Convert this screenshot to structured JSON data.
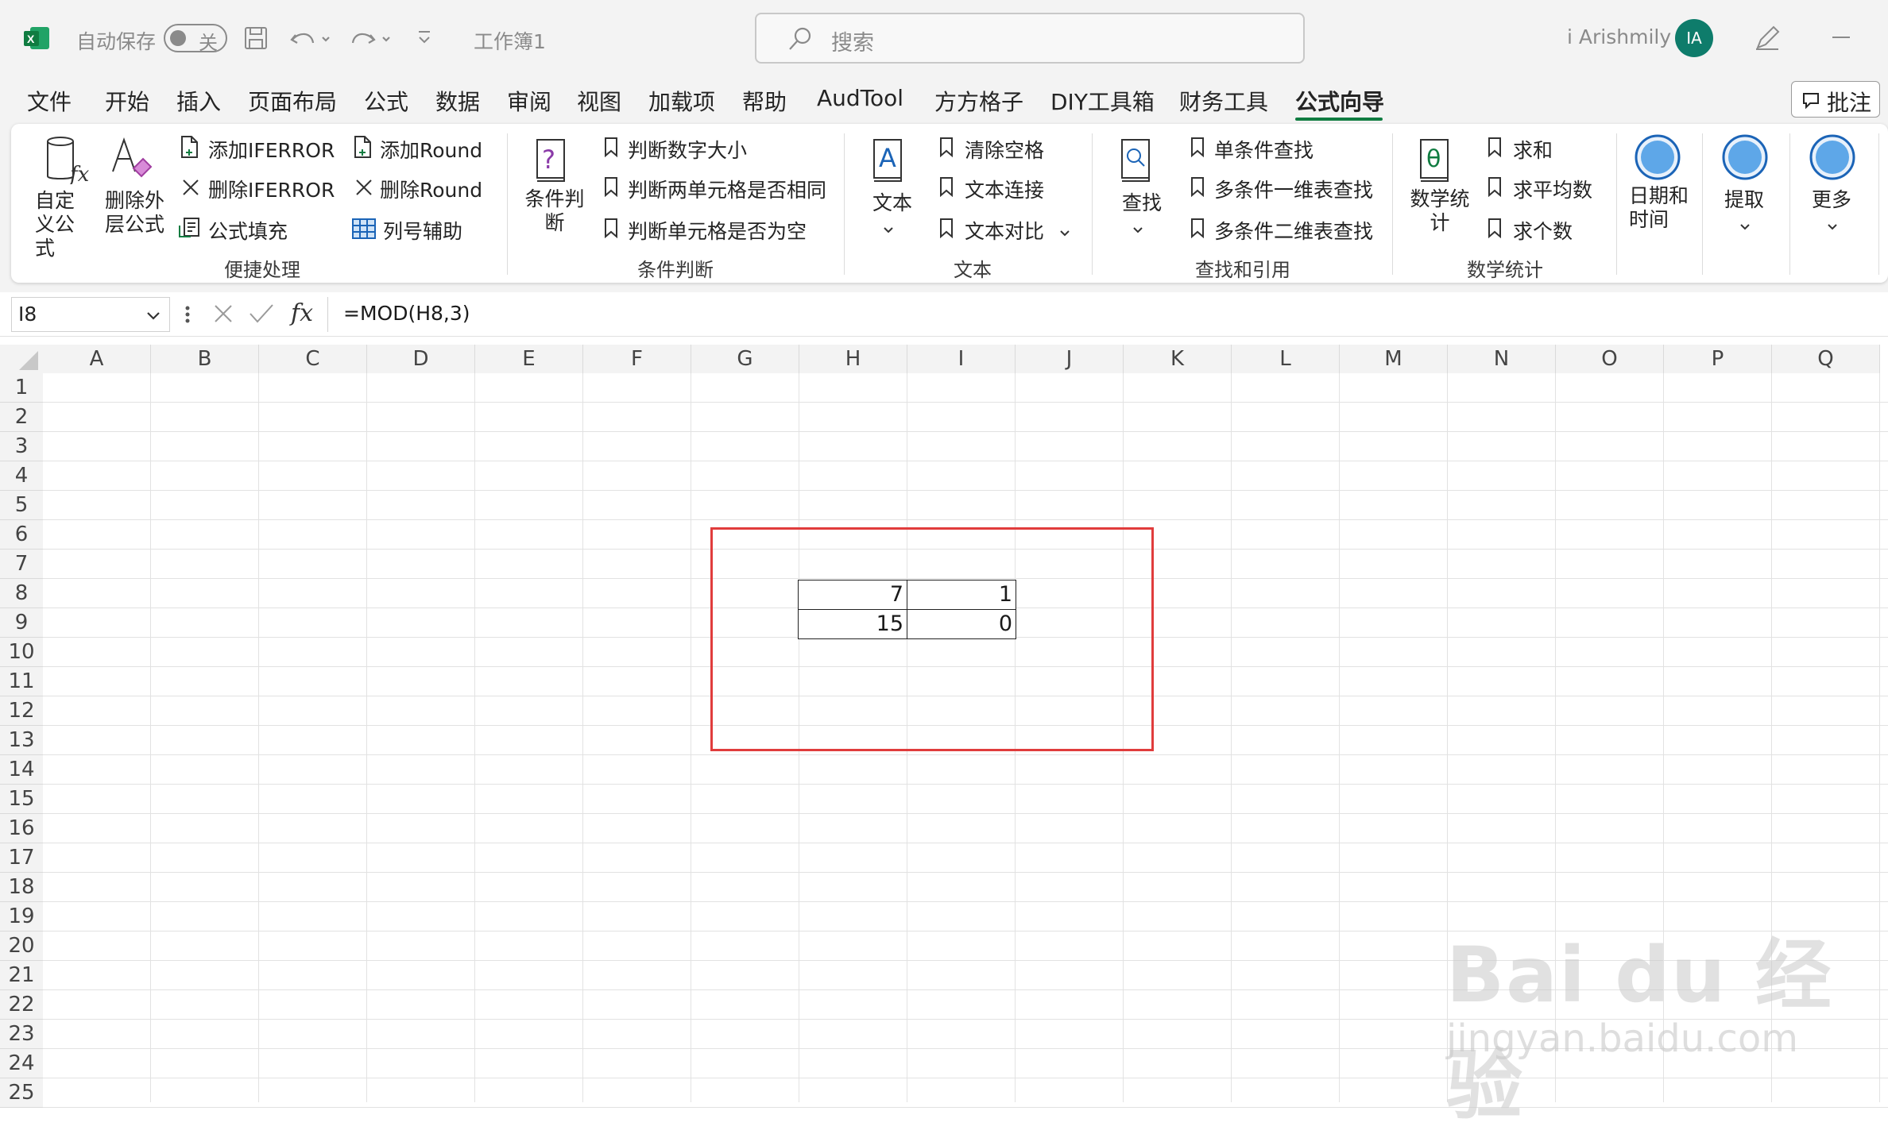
{
  "titlebar": {
    "autosave_label": "自动保存",
    "toggle_label": "关",
    "workbook_name": "工作簿1",
    "search_placeholder": "搜索",
    "user_name": "i Arishmily",
    "avatar_initials": "IA"
  },
  "menu": {
    "tabs": [
      "文件",
      "开始",
      "插入",
      "页面布局",
      "公式",
      "数据",
      "审阅",
      "视图",
      "加载项",
      "帮助",
      "AudTool",
      "方方格子",
      "DIY工具箱",
      "财务工具",
      "公式向导"
    ],
    "active": "公式向导",
    "comment_button": "批注"
  },
  "ribbon": {
    "convenience": {
      "custom_formula": "自定义公式",
      "delete_outer": "删除外层公式",
      "add_iferror": "添加IFERROR",
      "del_iferror": "删除IFERROR",
      "formula_fill": "公式填充",
      "add_round": "添加Round",
      "del_round": "删除Round",
      "col_assist": "列号辅助",
      "group": "便捷处理"
    },
    "condition": {
      "big": "条件判断",
      "item1": "判断数字大小",
      "item2": "判断两单元格是否相同",
      "item3": "判断单元格是否为空",
      "group": "条件判断"
    },
    "text": {
      "big": "文本",
      "item1": "清除空格",
      "item2": "文本连接",
      "item3": "文本对比",
      "group": "文本"
    },
    "lookup": {
      "big": "查找",
      "item1": "单条件查找",
      "item2": "多条件一维表查找",
      "item3": "多条件二维表查找",
      "group": "查找和引用"
    },
    "math": {
      "big": "数学统计",
      "item1": "求和",
      "item2": "求平均数",
      "item3": "求个数",
      "group": "数学统计"
    },
    "datetime": {
      "label": "日期和时间"
    },
    "extract": {
      "label": "提取"
    },
    "more": {
      "label": "更多"
    }
  },
  "formula_bar": {
    "name_box": "I8",
    "formula": "=MOD(H8,3)"
  },
  "sheet": {
    "columns": [
      "A",
      "B",
      "C",
      "D",
      "E",
      "F",
      "G",
      "H",
      "I",
      "J",
      "K",
      "L",
      "M",
      "N",
      "O",
      "P",
      "Q"
    ],
    "rows": [
      "1",
      "2",
      "3",
      "4",
      "5",
      "6",
      "7",
      "8",
      "9",
      "10",
      "11",
      "12",
      "13",
      "14",
      "15",
      "16",
      "17",
      "18",
      "19",
      "20",
      "21",
      "22",
      "23",
      "24",
      "25"
    ],
    "cells": {
      "H8": "7",
      "I8": "1",
      "H9": "15",
      "I9": "0"
    }
  },
  "watermark": {
    "line1": "Bai du 经验",
    "line2": "jingyan.baidu.com"
  },
  "colors": {
    "excel_green": "#107c41",
    "highlight_red": "#e03c3c"
  }
}
